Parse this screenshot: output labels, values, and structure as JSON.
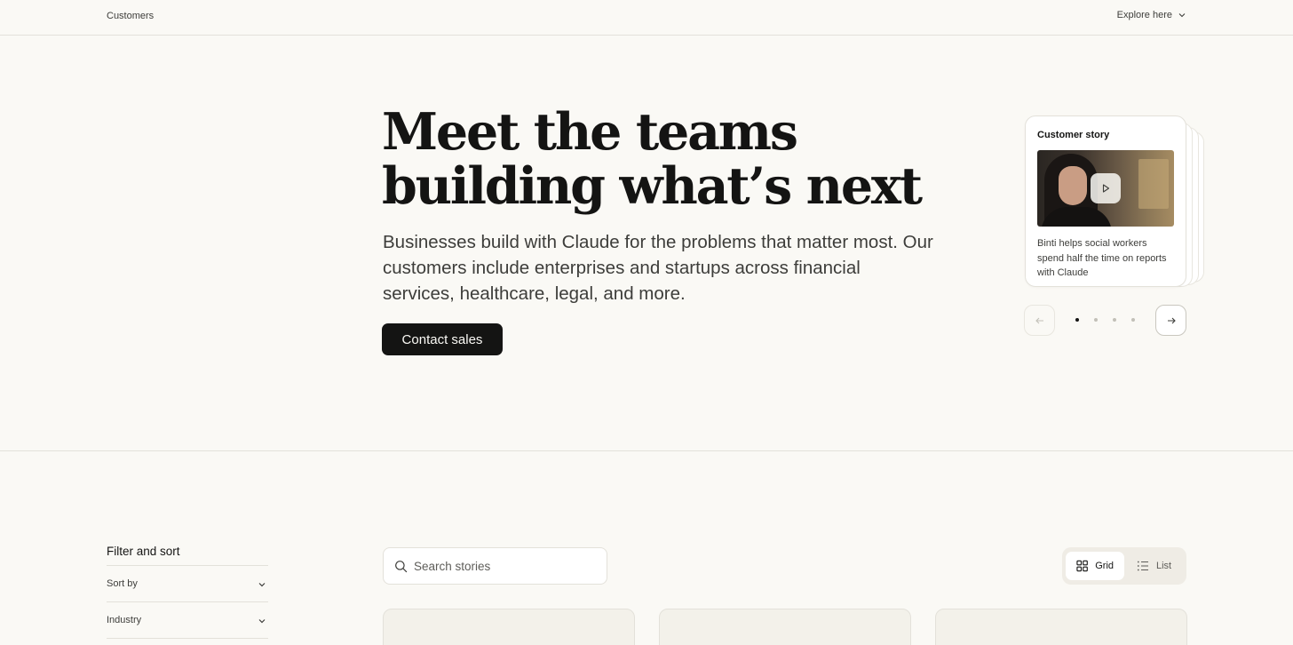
{
  "nav": {
    "brand": "Customers",
    "explore_label": "Explore here"
  },
  "hero": {
    "title_line1": "Meet the teams",
    "title_line2": "building what’s next",
    "subtitle": "Businesses build with Claude for the problems that matter most. Our customers include enterprises and startups across financial services, healthcare, legal, and more.",
    "cta_label": "Contact sales"
  },
  "story": {
    "label": "Customer story",
    "text": "Binti helps social workers spend half the time on reports with Claude",
    "video_icon": "play-icon"
  },
  "carousel": {
    "total_slides": 4,
    "active_slide": 1,
    "prev_icon": "arrow-left-icon",
    "next_icon": "arrow-right-icon"
  },
  "filters": {
    "title": "Filter and sort",
    "items": [
      {
        "label": "Sort by"
      },
      {
        "label": "Industry"
      }
    ]
  },
  "search": {
    "placeholder": "Search stories",
    "value": ""
  },
  "view_toggle": {
    "options": [
      {
        "label": "Grid",
        "icon": "grid-icon",
        "selected": true
      },
      {
        "label": "List",
        "icon": "list-icon",
        "selected": false
      }
    ]
  },
  "colors": {
    "background": "#faf9f5",
    "text": "#141413",
    "button_bg": "#141413",
    "border": "#e3e1da"
  }
}
